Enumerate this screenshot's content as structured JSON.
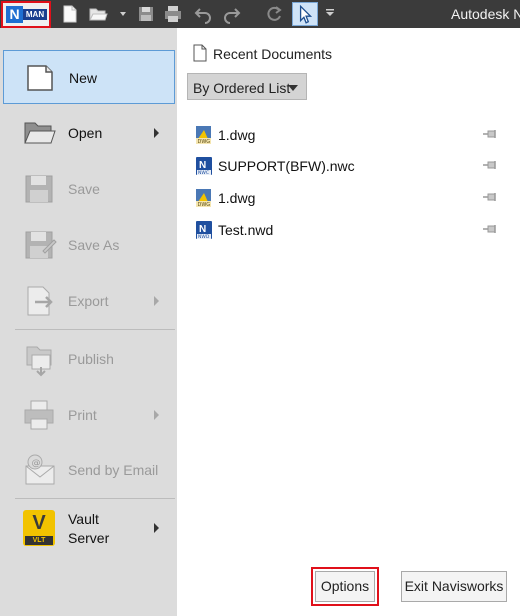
{
  "title_bar": {
    "app_logo_letter": "N",
    "app_logo_badge": "MAN",
    "window_title": "Autodesk N"
  },
  "quick_access": [
    "new-file-icon",
    "open-folder-icon",
    "save-icon",
    "print-icon",
    "undo-icon",
    "redo-icon",
    "refresh-icon",
    "select-cursor-icon",
    "customize-caret-icon"
  ],
  "menu": {
    "new": "New",
    "open": "Open",
    "save": "Save",
    "save_as": "Save As",
    "export": "Export",
    "publish": "Publish",
    "print": "Print",
    "send_by_email": "Send by Email",
    "vault_line1": "Vault",
    "vault_line2": "Server",
    "vault_badge": "V",
    "vault_badge_small": "VLT"
  },
  "recent": {
    "title": "Recent Documents",
    "sort_value": "By Ordered List",
    "docs": [
      {
        "name": "1.dwg",
        "type": "dwg",
        "badge": "DWG"
      },
      {
        "name": "SUPPORT(BFW).nwc",
        "type": "nwc",
        "badge": "NWC"
      },
      {
        "name": "1.dwg",
        "type": "dwg",
        "badge": "DWG"
      },
      {
        "name": "Test.nwd",
        "type": "nwd",
        "badge": "NWD"
      }
    ]
  },
  "footer": {
    "options": "Options",
    "exit": "Exit Navisworks"
  },
  "colors": {
    "titlebar": "#3b3b3b",
    "menu_bg": "#dcdcdc",
    "selected_bg": "#cde3f7",
    "highlight": "#e0101a",
    "nw_blue": "#1f6fd1",
    "vault_yellow": "#f2c300"
  }
}
